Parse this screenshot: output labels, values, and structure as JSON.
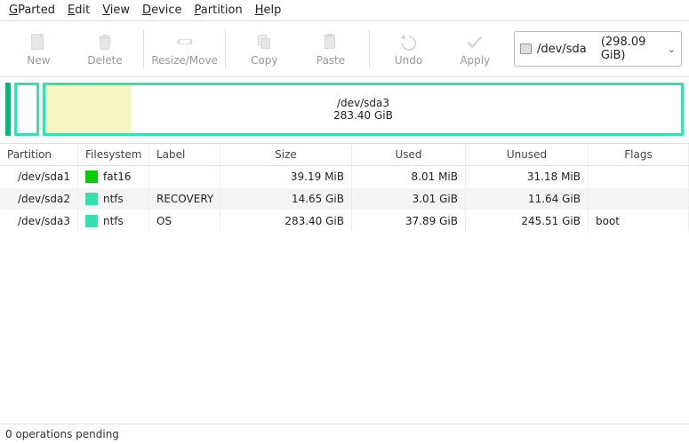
{
  "menu": {
    "gparted": "GParted",
    "edit": "Edit",
    "view": "View",
    "device": "Device",
    "partition": "Partition",
    "help": "Help"
  },
  "toolbar": {
    "new": "New",
    "delete": "Delete",
    "resize": "Resize/Move",
    "copy": "Copy",
    "paste": "Paste",
    "undo": "Undo",
    "apply": "Apply"
  },
  "device": {
    "path": "/dev/sda",
    "size": "(298.09 GiB)"
  },
  "diskmap": {
    "main_partition": "/dev/sda3",
    "main_size": "283.40 GiB"
  },
  "columns": {
    "partition": "Partition",
    "filesystem": "Filesystem",
    "label": "Label",
    "size": "Size",
    "used": "Used",
    "unused": "Unused",
    "flags": "Flags"
  },
  "rows": [
    {
      "partition": "/dev/sda1",
      "fs": "fat16",
      "swatch": "sw-fat16",
      "label": "",
      "size": "39.19 MiB",
      "used": "8.01 MiB",
      "unused": "31.18 MiB",
      "flags": ""
    },
    {
      "partition": "/dev/sda2",
      "fs": "ntfs",
      "swatch": "sw-ntfs",
      "label": "RECOVERY",
      "size": "14.65 GiB",
      "used": "3.01 GiB",
      "unused": "11.64 GiB",
      "flags": ""
    },
    {
      "partition": "/dev/sda3",
      "fs": "ntfs",
      "swatch": "sw-ntfs",
      "label": "OS",
      "size": "283.40 GiB",
      "used": "37.89 GiB",
      "unused": "245.51 GiB",
      "flags": "boot"
    }
  ],
  "status": "0 operations pending"
}
